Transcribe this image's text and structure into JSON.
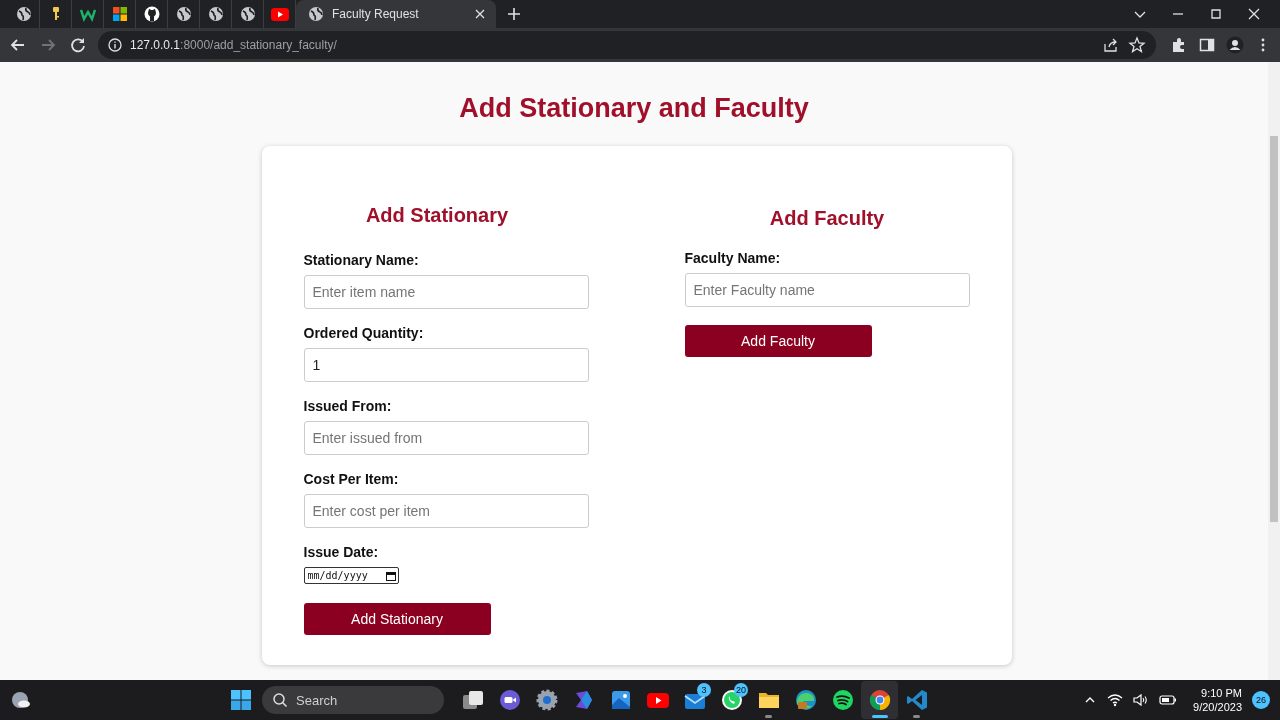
{
  "browser": {
    "tabs": [
      {
        "kind": "globe",
        "selected": false
      },
      {
        "kind": "key",
        "selected": false
      },
      {
        "kind": "w",
        "selected": false
      },
      {
        "kind": "windows",
        "selected": false
      },
      {
        "kind": "github",
        "selected": false
      },
      {
        "kind": "globe",
        "selected": false
      },
      {
        "kind": "globe",
        "selected": false
      },
      {
        "kind": "globe",
        "selected": false
      },
      {
        "kind": "youtube",
        "selected": false
      },
      {
        "kind": "globe",
        "selected": true,
        "label": "Faculty Request"
      }
    ],
    "url": {
      "host": "127.0.0.1",
      "path": ":8000/add_stationary_faculty/"
    }
  },
  "page": {
    "title": "Add Stationary and Faculty",
    "stationary": {
      "heading": "Add Stationary",
      "fields": [
        {
          "kind": "text",
          "label": "Stationary Name:",
          "placeholder": "Enter item name"
        },
        {
          "kind": "text",
          "label": "Ordered Quantity:",
          "value": "1"
        },
        {
          "kind": "text",
          "label": "Issued From:",
          "placeholder": "Enter issued from"
        },
        {
          "kind": "text",
          "label": "Cost Per Item:",
          "placeholder": "Enter cost per item"
        },
        {
          "kind": "date",
          "label": "Issue Date:",
          "placeholder": "mm/dd/yyyy"
        }
      ],
      "button": "Add Stationary"
    },
    "faculty": {
      "heading": "Add Faculty",
      "fields": [
        {
          "kind": "text",
          "label": "Faculty Name:",
          "placeholder": "Enter Faculty name"
        }
      ],
      "button": "Add Faculty"
    }
  },
  "taskbar": {
    "search": {
      "placeholder": "Search"
    },
    "apps": [
      {
        "kind": "taskview",
        "running": false,
        "selected": false
      },
      {
        "kind": "meet",
        "running": false,
        "selected": false
      },
      {
        "kind": "settings",
        "running": false,
        "selected": false
      },
      {
        "kind": "copilot",
        "running": false,
        "selected": false
      },
      {
        "kind": "photos",
        "running": false,
        "selected": false
      },
      {
        "kind": "youtube",
        "running": false,
        "selected": false
      },
      {
        "kind": "mail",
        "running": false,
        "selected": false,
        "badge": "3"
      },
      {
        "kind": "whatsapp",
        "running": false,
        "selected": false,
        "badge": "20"
      },
      {
        "kind": "folder",
        "running": true,
        "selected": false
      },
      {
        "kind": "edge",
        "running": false,
        "selected": false
      },
      {
        "kind": "spotify",
        "running": false,
        "selected": false
      },
      {
        "kind": "chrome",
        "running": true,
        "selected": true
      },
      {
        "kind": "vscode",
        "running": true,
        "selected": false
      }
    ],
    "time": "9:10 PM",
    "date": "9/20/2023",
    "notifications": "26"
  }
}
